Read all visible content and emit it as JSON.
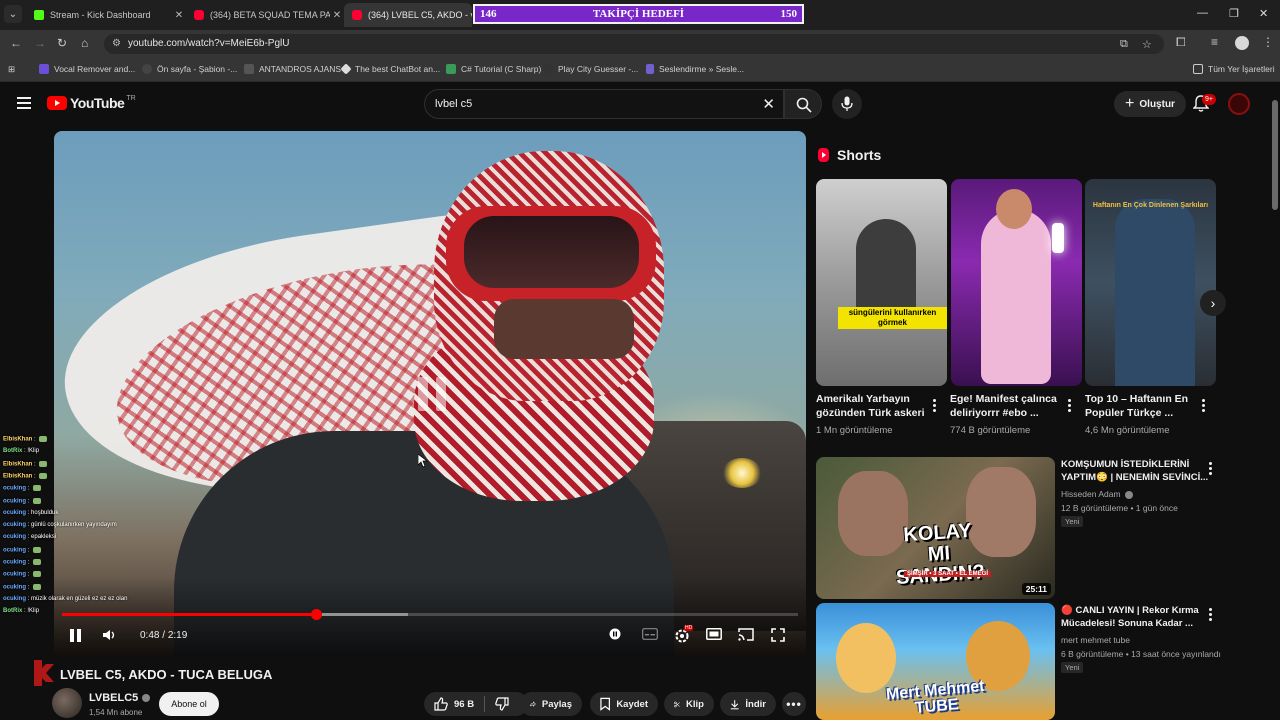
{
  "browser": {
    "tabs": [
      {
        "title": "Stream - Kick Dashboard",
        "favicon": "kick-icon"
      },
      {
        "title": "(364) BETA SQUAD TEMA PARK",
        "favicon": "youtube-icon"
      },
      {
        "title": "(364) LVBEL C5, AKDO - vO",
        "favicon": "youtube-icon"
      }
    ],
    "url": "youtube.com/watch?v=MeiE6b-PglU",
    "bookmarks": [
      "Vocal Remover and...",
      "Ön sayfa - Şabion -...",
      "ANTANDROS AJANS",
      "The best ChatBot an...",
      "C# Tutorial (C Sharp)",
      "Play City Guesser -...",
      "Seslendirme » Sesle..."
    ],
    "all_bookmarks": "Tüm Yer İşaretleri"
  },
  "goal_overlay": {
    "current": "146",
    "label": "TAKİPÇİ HEDEFİ",
    "target": "150",
    "accent": "#7a27c9"
  },
  "youtube": {
    "logo_text": "YouTube",
    "country_code": "TR",
    "search_query": "lvbel c5",
    "create_label": "Oluştur",
    "notifications": "9+"
  },
  "player": {
    "time_current": "0:48",
    "time_separator": "/",
    "time_total": "2:19",
    "progress_fraction": 0.345,
    "buffer_fraction": 0.47,
    "accent": "#ff0000"
  },
  "chat": [
    {
      "user": "ElbisKhan",
      "msg": ""
    },
    {
      "user": "BotRix",
      "msg": "!Klip"
    },
    {
      "user": "ElbisKhan",
      "msg": ""
    },
    {
      "user": "ElbisKhan",
      "msg": ""
    },
    {
      "user": "ocuking",
      "msg": ""
    },
    {
      "user": "ocuking",
      "msg": ""
    },
    {
      "user": "ocuking",
      "msg": "hoşbulduk"
    },
    {
      "user": "ocuking",
      "msg": "günlü coşkulanırken yayındayım"
    },
    {
      "user": "ocuking",
      "msg": "epakleksi"
    },
    {
      "user": "ocuking",
      "msg": ""
    },
    {
      "user": "ocuking",
      "msg": ""
    },
    {
      "user": "ocuking",
      "msg": ""
    },
    {
      "user": "ocuking",
      "msg": ""
    },
    {
      "user": "ocuking",
      "msg": "müzik olarak en güzeli ez ez ez olan"
    },
    {
      "user": "BotRix",
      "msg": "!Klip"
    }
  ],
  "video": {
    "title": "LVBEL C5, AKDO - TUCA BELUGA",
    "channel": "LVBELC5",
    "subscribers": "1,54 Mn abone",
    "subscribe_label": "Abone ol",
    "likes": "96 B",
    "share_label": "Paylaş",
    "save_label": "Kaydet",
    "clip_label": "Klip",
    "download_label": "İndir"
  },
  "shorts": {
    "heading": "Shorts",
    "items": [
      {
        "title": "Amerikalı Yarbayın gözünden Türk askeri",
        "views": "1 Mn görüntüleme",
        "caption": "süngülerini kullanırken görmek"
      },
      {
        "title": "Ege! Manifest çalınca deliriyorrr #ebo ...",
        "views": "774 B görüntüleme"
      },
      {
        "title": "Top 10 – Haftanın En Popüler Türkçe ...",
        "views": "4,6 Mn görüntüleme",
        "caption": "Haftanın En Çok Dinlenen Şarkıları"
      }
    ]
  },
  "recommendations": [
    {
      "title": "KOMŞUMUN İSTEDİKLERİNİ YAPTIM😳 | NENEMİN SEVİNCİ...",
      "channel": "Hisseden Adam",
      "meta": "12 B görüntüleme • 1 gün önce",
      "badge": "Yeni",
      "duration": "25:11",
      "thumb_text": "KOLAY MI SANDIN?",
      "thumb_sub": "ŞİMŞİR • 3 SAAT • EL EMEĞİ"
    },
    {
      "title": "🔴 CANLI YAYIN | Rekor Kırma Mücadelesi! Sonuna Kadar ...",
      "channel": "mert mehmet tube",
      "meta": "6 B görüntüleme • 13 saat önce yayınlandı",
      "badge": "Yeni",
      "thumb_text": "Mert Mehmet TUBE"
    }
  ]
}
